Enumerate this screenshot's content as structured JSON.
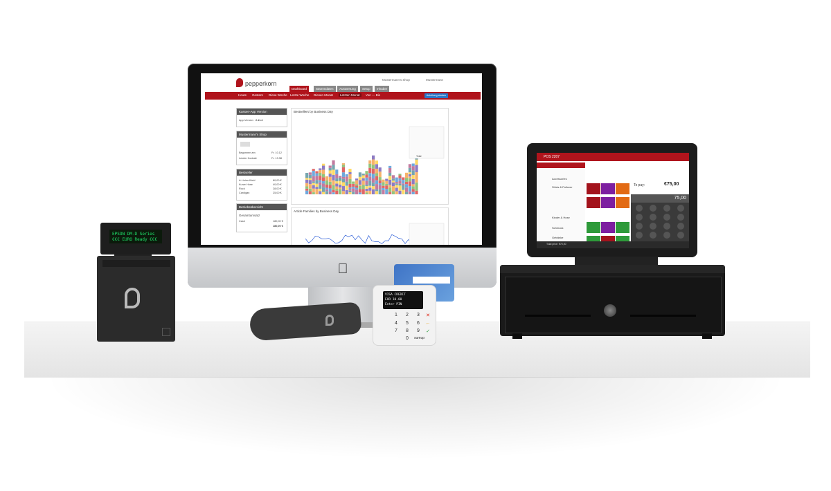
{
  "webapp": {
    "logo": "pepperkorn",
    "header_links": [
      "Mustermann's Shop",
      "Mustermann"
    ],
    "tabs": [
      "Dashboard",
      "Stammdaten",
      "Auswertung",
      "Setup",
      "Inhaber"
    ],
    "subnav": [
      "Heute",
      "Gestern",
      "Diese Woche",
      "Letzte Woche",
      "Diesen Monat",
      "Letzten Monat",
      "Von — Bis"
    ],
    "cta": "Anleitung starten",
    "panels": {
      "app_version": {
        "title": "Kassen-App Version",
        "label": "App-Version",
        "value": "2.11.4"
      },
      "shop": {
        "title": "Mustermann's Shop",
        "rows": [
          [
            "Begonnen am",
            "Fr. 10.12"
          ],
          [
            "Letzter Kontakt",
            "Fr. 13.38"
          ]
        ]
      },
      "bestseller": {
        "title": "Bestseller",
        "rows": [
          [
            "A-Linien Kleid",
            "80,00 €"
          ],
          [
            "Kurze Hose",
            "40,00 €"
          ],
          [
            "Rock",
            "28,00 €"
          ],
          [
            "Cardigan",
            "25,00 €"
          ]
        ]
      },
      "overview": {
        "title": "Betriebsübersicht",
        "label": "Gesamtumsatz",
        "rows": [
          [
            "Cash",
            "180,00 €"
          ],
          [
            "",
            "180,00 €"
          ]
        ]
      }
    },
    "chart1_title": "Bestsellers by Business Day",
    "chart1_legend_total": "Total",
    "chart2_title": "Article Families by Business Day"
  },
  "pos": {
    "header": "POS 2207",
    "categories": [
      "Accessories",
      "Shirts & Pullover",
      "Kinder & Hose",
      "Schmuck",
      "Getränke"
    ],
    "to_pay_label": "To pay:",
    "to_pay_value": "€75,00",
    "entered": "75,00",
    "total_label": "Total price: €75,00"
  },
  "display": {
    "line1": "EPSON DM-D Series",
    "line2": "€€€ EURO Ready €€€"
  },
  "reader": {
    "line1": "VISA CREDIT",
    "line2": "EUR 10.00",
    "line3": "Enter PIN",
    "keys": [
      "1",
      "2",
      "3",
      "4",
      "5",
      "6",
      "7",
      "8",
      "9",
      "0"
    ],
    "brand": "sumup"
  },
  "colors": {
    "brand_red": "#b0141c",
    "accent_blue": "#2877c9"
  }
}
